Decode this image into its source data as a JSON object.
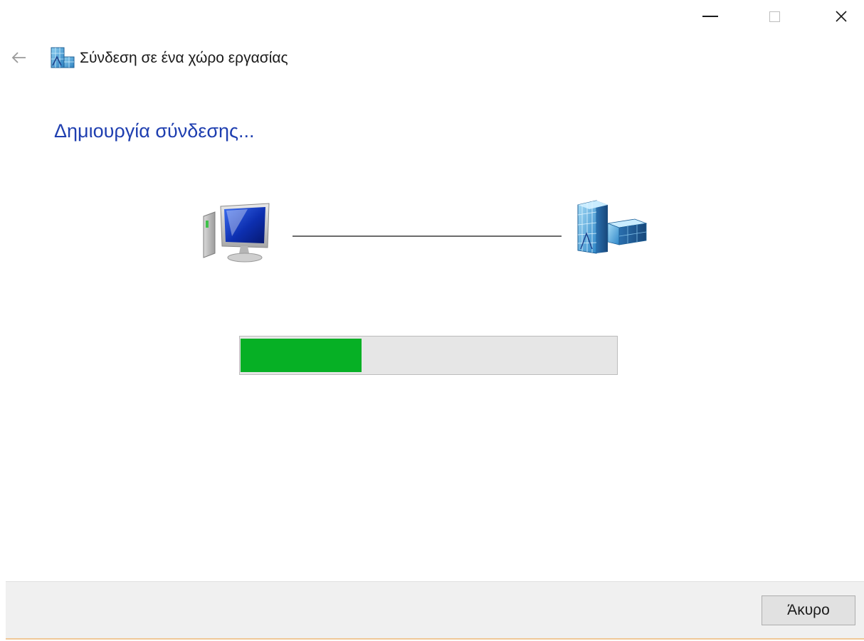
{
  "window": {
    "title": "Σύνδεση σε ένα χώρο εργασίας",
    "caption_buttons": {
      "minimize_icon": "minimize-icon",
      "maximize_icon": "maximize-icon",
      "close_icon": "close-icon"
    }
  },
  "header": {
    "back_icon": "back-arrow-icon",
    "app_icon": "workplace-connection-icon"
  },
  "main": {
    "heading": "Δημιουργία σύνδεσης...",
    "illustration": {
      "left_icon": "computer-icon",
      "right_icon": "office-building-icon"
    },
    "progress": {
      "value_percent": 32,
      "color": "#06b025"
    }
  },
  "footer": {
    "cancel_label": "Άκυρο"
  },
  "colors": {
    "heading": "#1f3fb0",
    "progress_fill": "#06b025",
    "progress_track": "#e6e6e6",
    "footer_bg": "#f0f0f0"
  }
}
